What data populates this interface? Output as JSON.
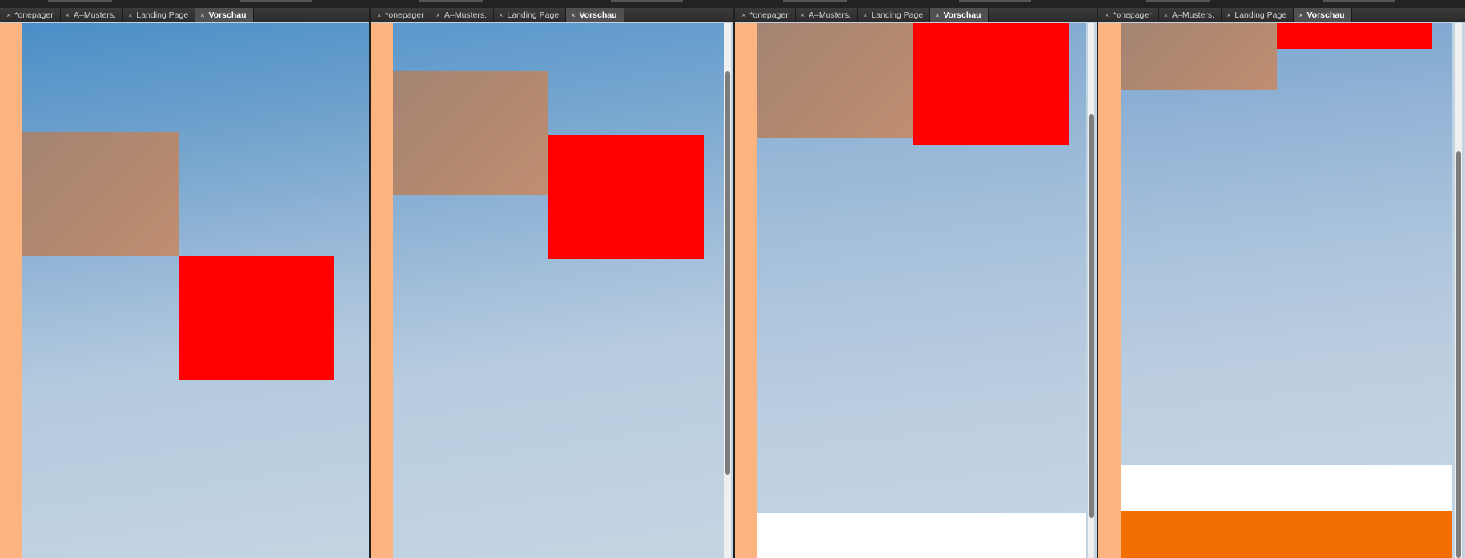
{
  "panels": [
    {
      "tabs": [
        "*onepager",
        "A–Musters.",
        "Landing Page",
        "Vorschau"
      ],
      "active_tab": 3,
      "close_glyph": "×",
      "close_icon": "close-icon"
    },
    {
      "tabs": [
        "*onepager",
        "A–Musters.",
        "Landing Page",
        "Vorschau"
      ],
      "active_tab": 3,
      "close_glyph": "×",
      "close_icon": "close-icon"
    },
    {
      "tabs": [
        "*onepager",
        "A–Musters.",
        "Landing Page",
        "Vorschau"
      ],
      "active_tab": 3,
      "close_glyph": "×",
      "close_icon": "close-icon"
    },
    {
      "tabs": [
        "*onepager",
        "A–Musters.",
        "Landing Page",
        "Vorschau"
      ],
      "active_tab": 3,
      "close_glyph": "×",
      "close_icon": "close-icon"
    }
  ],
  "colors": {
    "sidebar_strip": "#fbb47f",
    "brown_box": "#b3896f",
    "red_box": "#ff0000",
    "orange_band": "#f26e00",
    "white_band": "#ffffff",
    "sky_top": "#4a8ec8",
    "sky_bottom": "#c4d4e2",
    "active_tab": "#505050",
    "tab_bar": "#333333"
  }
}
